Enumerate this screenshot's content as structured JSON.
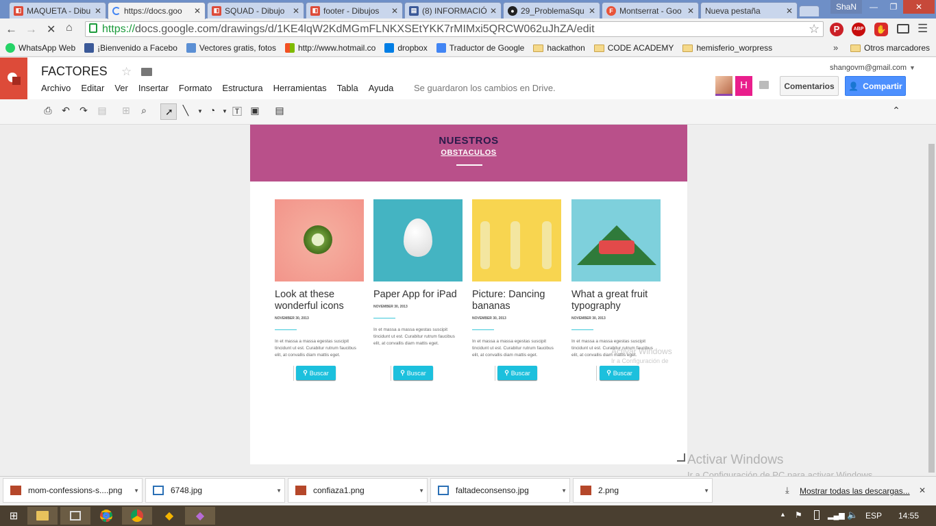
{
  "tabs": [
    {
      "title": "MAQUETA - Dibu",
      "active": false,
      "color": "#dd4b39"
    },
    {
      "title": "https://docs.goo",
      "active": true,
      "color": "#4285f4"
    },
    {
      "title": "SQUAD - Dibujo",
      "active": false,
      "color": "#dd4b39"
    },
    {
      "title": "footer - Dibujos",
      "active": false,
      "color": "#dd4b39"
    },
    {
      "title": "(8) INFORMACIÓ",
      "active": false,
      "color": "#3b5998"
    },
    {
      "title": "29_ProblemaSqu",
      "active": false,
      "color": "#222222"
    },
    {
      "title": "Montserrat - Goo",
      "active": false,
      "color": "#e8543a"
    },
    {
      "title": "Nueva pestaña",
      "active": false,
      "color": ""
    }
  ],
  "window": {
    "user": "ShaN",
    "minimize": "—",
    "maximize": "❐",
    "close": "✕"
  },
  "address": {
    "scheme": "https://",
    "url": "docs.google.com/drawings/d/1KE4lqW2KdMGmFLNKXSEtYKK7rMIMxi5QRCW062uJhZA/edit"
  },
  "bookmarks": [
    {
      "label": "WhatsApp Web",
      "icon": "whatsapp-icon",
      "color": "#25d366"
    },
    {
      "label": "¡Bienvenido a Facebo",
      "icon": "facebook-icon",
      "color": "#3b5998"
    },
    {
      "label": "Vectores gratis, fotos",
      "icon": "freepik-icon",
      "color": "#5b8fd4"
    },
    {
      "label": "http://www.hotmail.co",
      "icon": "windows-icon",
      "color": "#f25022"
    },
    {
      "label": "dropbox",
      "icon": "dropbox-icon",
      "color": "#007ee5"
    },
    {
      "label": "Traductor de Google",
      "icon": "translate-icon",
      "color": "#4285f4"
    },
    {
      "label": "hackathon",
      "icon": "folder-icon",
      "color": ""
    },
    {
      "label": "CODE ACADEMY",
      "icon": "folder-icon",
      "color": ""
    },
    {
      "label": "hemisferio_worpress",
      "icon": "folder-icon",
      "color": ""
    }
  ],
  "bookmarks_more": "»",
  "other_bookmarks": "Otros marcadores",
  "doc": {
    "title": "FACTORES",
    "menus": [
      "Archivo",
      "Editar",
      "Ver",
      "Insertar",
      "Formato",
      "Estructura",
      "Herramientas",
      "Tabla",
      "Ayuda"
    ],
    "saved": "Se guardaron los cambios en Drive.",
    "email": "shangovm@gmail.com",
    "avatar_letter": "H",
    "comments_label": "Comentarios",
    "share_label": "Compartir"
  },
  "design": {
    "banner_title": "NUESTROS",
    "banner_subtitle": "OBSTACULOS",
    "cards": [
      {
        "title": "Look at these wonderful icons",
        "date": "NOVEMBER 30, 2013",
        "text": "In et massa a massa egestas suscipit tincidunt ut est. Curabitur rutrum faucibus elit, at convallis diam mattis eget.",
        "button": "Buscar",
        "image": "pink-background-cucumber"
      },
      {
        "title": "Paper App for iPad",
        "date": "NOVEMBER 30, 2013",
        "text": "In et massa a massa egestas suscipit tincidunt ut est. Curabitur rutrum faucibus elit, at convallis diam mattis eget.",
        "button": "Buscar",
        "image": "teal-background-egg"
      },
      {
        "title": "Picture: Dancing bananas",
        "date": "NOVEMBER 30, 2013",
        "text": "In et massa a massa egestas suscipit tincidunt ut est. Curabitur rutrum faucibus elit, at convallis diam mattis eget.",
        "button": "Buscar",
        "image": "yellow-background-bananas"
      },
      {
        "title": "What a great fruit typography",
        "date": "NOVEMBER 30, 2013",
        "text": "In et massa a massa egestas suscipit tincidunt ut est. Curabitur rutrum faucibus elit, at convallis diam mattis eget.",
        "button": "Buscar",
        "image": "blue-background-watermelon"
      }
    ],
    "overlay_watermark_1": "Activar Windows",
    "overlay_watermark_2": "Ir a Configuración de"
  },
  "watermark": {
    "line1": "Activar Windows",
    "line2": "Ir a Configuración de PC para activar Windows."
  },
  "downloads": [
    {
      "name": "mom-confessions-s....png"
    },
    {
      "name": "6748.jpg"
    },
    {
      "name": "confiaza1.png"
    },
    {
      "name": "faltadeconsenso.jpg"
    },
    {
      "name": "2.png"
    }
  ],
  "show_all_downloads": "Mostrar todas las descargas...",
  "taskbar": {
    "lang": "ESP",
    "time": "14:55"
  }
}
